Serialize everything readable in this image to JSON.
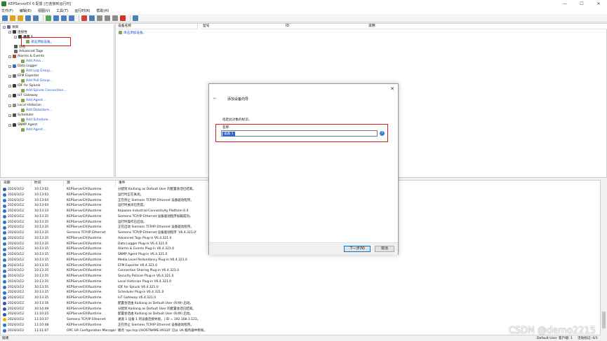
{
  "window": {
    "title": "KEPServerEX 6 配置 [已连接到运行时]",
    "controls": [
      "—",
      "☐",
      "✕"
    ]
  },
  "menu": [
    "文件(F)",
    "编辑(E)",
    "视图(V)",
    "工具(T)",
    "运行时(R)",
    "帮助(H)"
  ],
  "toolbar_colors": [
    "#4a7ebb",
    "#e0a020",
    "#e0a020",
    "#4a7ebb",
    "#4a7ebb",
    "#58a65c",
    "#4a7ebb",
    "#4a7ebb",
    "#4a7ebb",
    "#d04040",
    "#4a7ebb",
    "#8a8a8a",
    "#8a8a8a",
    "#8a8a8a",
    "#d43030",
    "#4a7ebb"
  ],
  "tree": {
    "project": "项目",
    "connectivity": "连接性",
    "channel": "通道 1",
    "add_device": "单击添加设备。",
    "aliases": "别名",
    "advanced_tags": "Advanced Tags",
    "alarms_events": "Alarms & Events",
    "add_area": "Add Area...",
    "data_logger": "Data Logger",
    "add_log_group": "Add Log Group...",
    "efm_exporter": "EFM Exporter",
    "add_poll_group": "Add Poll Group...",
    "idf_splunk": "IDF for Splunk",
    "add_splunk": "Add Splunk Connection...",
    "iot_gateway": "IoT Gateway",
    "add_agent_iot": "Add Agent...",
    "local_historian": "Local Historian",
    "add_datastore": "Add Datastore...",
    "scheduler": "Scheduler",
    "add_schedule": "Add Schedule...",
    "snmp_agent": "SNMP Agent",
    "add_agent_snmp": "Add Agent..."
  },
  "device_pane": {
    "columns": [
      "设备名称",
      "型号",
      "ID",
      "说明"
    ],
    "add_device_link": "单击添加设备。"
  },
  "log": {
    "columns": [
      "日期",
      "时间",
      "源",
      "事件"
    ],
    "rows": [
      {
        "date": "2024/3/12",
        "time": "10:13:02",
        "source": "KEPServerEX\\Runtime",
        "event": "分配到 Kailiang as Default User 的配置会话已结束。",
        "level": "security"
      },
      {
        "date": "2024/3/12",
        "time": "10:13:03",
        "source": "KEPServerEX\\Runtime",
        "event": "运行时正在关闭。",
        "level": "info"
      },
      {
        "date": "2024/3/12",
        "time": "10:13:04",
        "source": "KEPServerEX\\Runtime",
        "event": "正在停止 Siemens TCP/IP Ethernet 设备驱动程序。",
        "level": "info"
      },
      {
        "date": "2024/3/12",
        "time": "10:13:04",
        "source": "KEPServerEX\\Runtime",
        "event": "运行时关闭已完成。",
        "level": "info"
      },
      {
        "date": "2024/3/12",
        "time": "10:13:33",
        "source": "KEPServerEX\\Runtime",
        "event": "Kepware Industrial Connectivity Platform 6.4",
        "level": "info"
      },
      {
        "date": "2024/3/12",
        "time": "10:13:35",
        "source": "KEPServerEX\\Runtime",
        "event": "Siemens TCP/IP Ethernet 设备驱动程序加载成功。",
        "level": "info"
      },
      {
        "date": "2024/3/12",
        "time": "10:13:35",
        "source": "KEPServerEX\\Runtime",
        "event": "运行时操作已启动。",
        "level": "info"
      },
      {
        "date": "2024/3/12",
        "time": "10:13:35",
        "source": "KEPServerEX\\Runtime",
        "event": "正在启动 Siemens TCP/IP Ethernet 设备驱动程序。",
        "level": "info"
      },
      {
        "date": "2024/3/12",
        "time": "10:13:35",
        "source": "Siemens TCP/IP Ethernet",
        "event": "Siemens TCP/IP Ethernet 设备驱动程序 'V6.4.321.0'",
        "level": "info"
      },
      {
        "date": "2024/3/12",
        "time": "10:13:35",
        "source": "KEPServerEX\\Runtime",
        "event": "Advanced Tags Plug-in V6.4.321.0",
        "level": "info"
      },
      {
        "date": "2024/3/12",
        "time": "10:13:35",
        "source": "KEPServerEX\\Runtime",
        "event": "Data Logger Plug-in V6.4.321.0",
        "level": "info"
      },
      {
        "date": "2024/3/12",
        "time": "10:13:35",
        "source": "KEPServerEX\\Runtime",
        "event": "Alarms & Events Plug-in V6.4.321.0",
        "level": "info"
      },
      {
        "date": "2024/3/12",
        "time": "10:13:35",
        "source": "KEPServerEX\\Runtime",
        "event": "SNMP Agent Plug-in V6.4.321.0",
        "level": "info"
      },
      {
        "date": "2024/3/12",
        "time": "10:13:35",
        "source": "KEPServerEX\\Runtime",
        "event": "Media Level Redundancy Plug-in V6.4.321.0",
        "level": "info"
      },
      {
        "date": "2024/3/12",
        "time": "10:13:35",
        "source": "KEPServerEX\\Runtime",
        "event": "EFM Exporter V6.4.321.0",
        "level": "info"
      },
      {
        "date": "2024/3/12",
        "time": "10:13:35",
        "source": "KEPServerEX\\Runtime",
        "event": "Connection Sharing Plug-in V6.4.321.0",
        "level": "info"
      },
      {
        "date": "2024/3/12",
        "time": "10:13:35",
        "source": "KEPServerEX\\Runtime",
        "event": "Security Policies Plug-in V6.4.321.0",
        "level": "info"
      },
      {
        "date": "2024/3/12",
        "time": "10:13:35",
        "source": "KEPServerEX\\Runtime",
        "event": "Local Historian Plug-in V6.4.321.0",
        "level": "info"
      },
      {
        "date": "2024/3/12",
        "time": "10:13:35",
        "source": "KEPServerEX\\Runtime",
        "event": "IDF for Splunk V6.4.321.0",
        "level": "info"
      },
      {
        "date": "2024/3/12",
        "time": "10:13:35",
        "source": "KEPServerEX\\Runtime",
        "event": "Scheduler Plug-in V6.4.321.0",
        "level": "info"
      },
      {
        "date": "2024/3/12",
        "time": "10:13:35",
        "source": "KEPServerEX\\Runtime",
        "event": "IoT Gateway V6.4.321.0",
        "level": "info"
      },
      {
        "date": "2024/3/12",
        "time": "10:13:36",
        "source": "KEPServerEX\\Runtime",
        "event": "配置会话由 Kailiang as Default User (R/W) 启动。",
        "level": "security"
      },
      {
        "date": "2024/3/12",
        "time": "10:14:49",
        "source": "KEPServerEX\\Runtime",
        "event": "分配到 Kailiang as Default User 的配置会话已结束。",
        "level": "security"
      },
      {
        "date": "2024/3/12",
        "time": "11:10:25",
        "source": "KEPServerEX\\Runtime",
        "event": "配置会话由 Kailiang as Default User (R/W) 启动。",
        "level": "security"
      },
      {
        "date": "2024/3/12",
        "time": "11:10:37",
        "source": "Siemens TCP/IP Ethernet",
        "event": "通道 1 设备 1 的设备连接失败。| ID = 192.168.3.123。",
        "level": "warning"
      },
      {
        "date": "2024/3/12",
        "time": "11:10:48",
        "source": "KEPServerEX\\Runtime",
        "event": "正在停止 Siemens TCP/IP Ethernet 设备驱动程序。",
        "level": "info"
      },
      {
        "date": "2024/3/12",
        "time": "11:11:07",
        "source": "OPC UA Configuration Manager",
        "event": "端点 'opc.tcp://HOSTNAME:49320' 已从 UA 服务器中移除。",
        "level": "info"
      }
    ]
  },
  "status": {
    "left": "就绪",
    "user": "Default User",
    "clients": "客户端: 1",
    "active_tags": "活动标记: 0/1"
  },
  "dialog": {
    "title": "添加设备向导",
    "back_icon": "←",
    "close_icon": "✕",
    "prompt": "指定此对象的标识。",
    "name_label": "名称:",
    "name_value": "设备 1",
    "help_icon": "?",
    "next_button": "下一步(N)",
    "cancel_button": "取消"
  },
  "watermark": "CSDN @demo2215",
  "colors": {
    "highlight": "#e01c1c",
    "link": "#1a4fd6",
    "selection": "#3366cc",
    "info": "#2f6fd1",
    "security": "#3551a8",
    "warning": "#e6b800"
  }
}
